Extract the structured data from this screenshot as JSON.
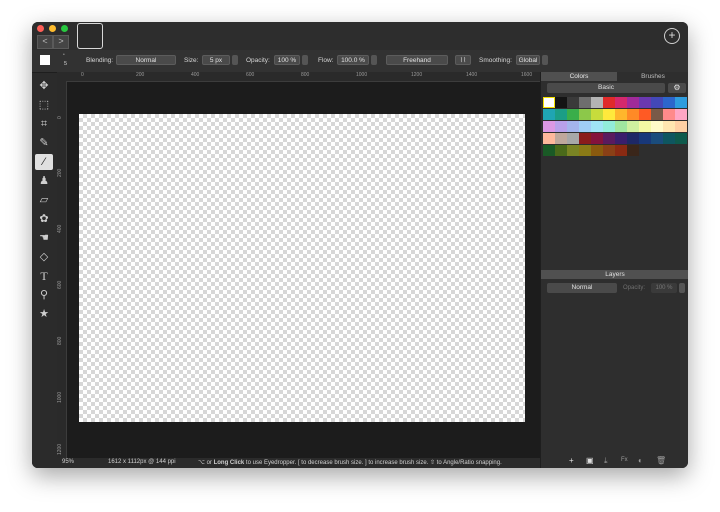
{
  "titlebar": {
    "nav_back": "<",
    "nav_forward": ">",
    "add_icon": "plus-circle-icon"
  },
  "options": {
    "brush_size_small": "5",
    "blending_label": "Blending:",
    "blending_value": "Normal",
    "size_label": "Size:",
    "size_value": "5 px",
    "opacity_label": "Opacity:",
    "opacity_value": "100 %",
    "flow_label": "Flow:",
    "flow_value": "100.0 %",
    "mode_value": "Freehand",
    "smoothing_label": "Smoothing:",
    "smoothing_value": "Global"
  },
  "tools": [
    {
      "name": "move-tool-icon",
      "glyph": "✥"
    },
    {
      "name": "marquee-tool-icon",
      "glyph": "⬚"
    },
    {
      "name": "crop-tool-icon",
      "glyph": "⌗"
    },
    {
      "name": "eyedropper-tool-icon",
      "glyph": "✎"
    },
    {
      "name": "brush-tool-icon",
      "glyph": "⁄"
    },
    {
      "name": "stamp-tool-icon",
      "glyph": "♟"
    },
    {
      "name": "eraser-tool-icon",
      "glyph": "▱"
    },
    {
      "name": "blur-tool-icon",
      "glyph": "✿"
    },
    {
      "name": "smudge-tool-icon",
      "glyph": "☚"
    },
    {
      "name": "fill-tool-icon",
      "glyph": "◇"
    },
    {
      "name": "text-tool-icon",
      "glyph": "T"
    },
    {
      "name": "zoom-tool-icon",
      "glyph": "⚲"
    },
    {
      "name": "favorites-tool-icon",
      "glyph": "★"
    }
  ],
  "ruler": {
    "top": [
      "0",
      "200",
      "400",
      "600",
      "800",
      "1000",
      "1200",
      "1400",
      "1600"
    ],
    "left": [
      "0",
      "200",
      "400",
      "600",
      "800",
      "1000",
      "1200"
    ]
  },
  "status": {
    "zoom": "95%",
    "dimensions": "1612 x 1112px @ 144 ppi",
    "hint_mod": "⌥ or ",
    "hint_bold": "Long Click",
    "hint_rest": " to use Eyedropper. [ to decrease brush size. ] to increase brush size. ⇧ to Angle/Ratio snapping."
  },
  "panel": {
    "tab_colors": "Colors",
    "tab_brushes": "Brushes",
    "palette_value": "Basic",
    "gear_icon": "gear-icon",
    "swatches": [
      "#ffffff",
      "#141414",
      "#3a3a3a",
      "#6e6e6e",
      "#b4b4b4",
      "#e02a2a",
      "#d4286c",
      "#a02a9a",
      "#6a38b0",
      "#4348b8",
      "#2c66cc",
      "#2e9cde",
      "#1fa5b3",
      "#1b9e86",
      "#3aae4a",
      "#8cc84a",
      "#c7dc3c",
      "#ffe93c",
      "#ffb62c",
      "#ff8a26",
      "#ff5a24",
      "#7a5a48",
      "#ff8a8a",
      "#ffa6c4",
      "#dc98e4",
      "#b8a0ea",
      "#a4b4ec",
      "#a0cdf6",
      "#a0e4f6",
      "#92ecda",
      "#a0e6a0",
      "#cff0a0",
      "#f4f8a4",
      "#fffac8",
      "#ffe6b0",
      "#ffd0a4",
      "#ffb89c",
      "#c0a89c",
      "#a8a8a8",
      "#8a1c1c",
      "#84123c",
      "#5a1a5e",
      "#3a1e6c",
      "#1e2866",
      "#18387a",
      "#1a4c7c",
      "#0e5660",
      "#0e5a4c",
      "#1a5a26",
      "#4a6a1a",
      "#7a8424",
      "#8a7a16",
      "#8a5a0e",
      "#8a4016",
      "#8a2a12",
      "#3a261a"
    ],
    "layers_title": "Layers",
    "layers_mode": "Normal",
    "layers_opacity_label": "Opacity:",
    "layers_opacity_value": "100 %",
    "footer_icons": [
      "add-layer-icon",
      "group-layer-icon",
      "download-icon",
      "fx-icon",
      "adjust-icon",
      "trash-icon"
    ]
  }
}
